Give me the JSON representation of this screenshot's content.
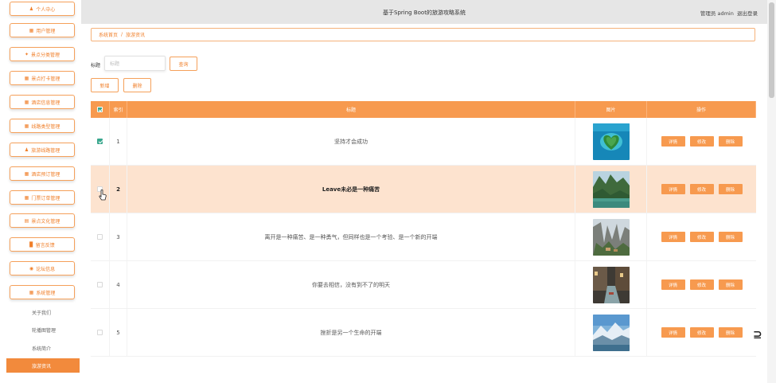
{
  "app": {
    "title": "基于Spring Boot的旅游攻略系统",
    "user_label": "管理员 admin",
    "logout_label": "退出登录"
  },
  "sidebar": {
    "menu": [
      {
        "label": "个人中心",
        "icon": "user-icon"
      },
      {
        "label": "用户管理",
        "icon": "grid-icon"
      },
      {
        "label": "景点分类管理",
        "icon": "tag-icon"
      },
      {
        "label": "景点打卡管理",
        "icon": "grid-icon"
      },
      {
        "label": "酒店信息管理",
        "icon": "grid-icon"
      },
      {
        "label": "线路类型管理",
        "icon": "grid-icon"
      },
      {
        "label": "旅游线路管理",
        "icon": "user-icon"
      },
      {
        "label": "酒店预订管理",
        "icon": "grid-icon"
      },
      {
        "label": "门票订单管理",
        "icon": "grid-icon"
      },
      {
        "label": "景点文化管理",
        "icon": "doc-icon"
      },
      {
        "label": "留言反馈",
        "icon": "chart-icon"
      },
      {
        "label": "论坛信息",
        "icon": "chat-icon"
      },
      {
        "label": "系统管理",
        "icon": "grid-icon"
      }
    ],
    "sub_items": [
      {
        "label": "关于我们"
      },
      {
        "label": "轮播图管理"
      },
      {
        "label": "系统简介"
      },
      {
        "label": "旅游资讯",
        "active": true
      }
    ]
  },
  "breadcrumb": {
    "home": "系统首页",
    "current": "旅游资讯"
  },
  "search": {
    "label": "标题",
    "placeholder": "标题",
    "button": "查询"
  },
  "actions": {
    "add": "新增",
    "delete": "删除"
  },
  "table": {
    "headers": {
      "index": "索引",
      "title": "标题",
      "image": "图片",
      "ops": "操作"
    },
    "op_labels": {
      "detail": "详情",
      "edit": "修改",
      "delete": "删除"
    },
    "rows": [
      {
        "index": "1",
        "title": "坚持才会成功",
        "checked": true,
        "image": "island-photo"
      },
      {
        "index": "2",
        "title": "Leave未必是一种痛苦",
        "checked": false,
        "hover": true,
        "image": "river-valley-photo"
      },
      {
        "index": "3",
        "title": "离开是一种痛苦、是一种勇气，但同样也是一个考验、是一个新的开端",
        "checked": false,
        "image": "cliff-village-photo"
      },
      {
        "index": "4",
        "title": "你要去相信，没有到不了的明天",
        "checked": false,
        "image": "canal-town-photo"
      },
      {
        "index": "5",
        "title": "挫折是另一个生命的开端",
        "checked": false,
        "image": "mountain-lake-photo"
      }
    ]
  },
  "colors": {
    "accent": "#f79a4f",
    "accent_text": "#f07f2a",
    "hover_row": "#fde3cf",
    "check": "#3aa78e"
  }
}
